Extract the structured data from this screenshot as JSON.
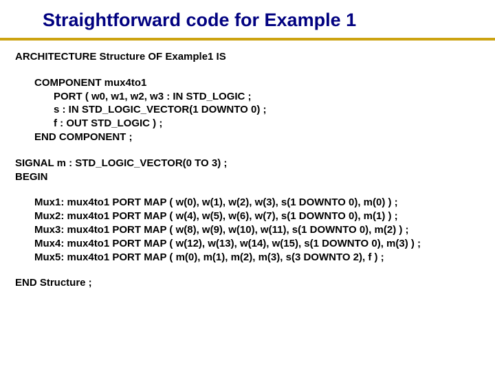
{
  "title": "Straightforward code for Example 1",
  "arch_line": "ARCHITECTURE Structure OF Example1 IS",
  "component": {
    "l1": "COMPONENT mux4to1",
    "l2": "PORT ( w0, w1, w2, w3 : IN STD_LOGIC ;",
    "l3": "s : IN STD_LOGIC_VECTOR(1 DOWNTO 0) ;",
    "l4": "f : OUT STD_LOGIC ) ;",
    "l5": "END COMPONENT ;"
  },
  "signal_line": "SIGNAL m : STD_LOGIC_VECTOR(0 TO 3) ;",
  "begin_line": "BEGIN",
  "mux": {
    "m1": "Mux1: mux4to1 PORT MAP ( w(0), w(1), w(2), w(3), s(1 DOWNTO 0), m(0) ) ;",
    "m2": "Mux2: mux4to1 PORT MAP ( w(4), w(5), w(6), w(7), s(1 DOWNTO 0), m(1) ) ;",
    "m3": "Mux3: mux4to1 PORT MAP ( w(8), w(9), w(10), w(11), s(1 DOWNTO 0), m(2) ) ;",
    "m4": "Mux4: mux4to1 PORT MAP ( w(12), w(13), w(14), w(15), s(1 DOWNTO 0), m(3) ) ;",
    "m5": "Mux5: mux4to1 PORT MAP ( m(0), m(1), m(2), m(3), s(3 DOWNTO 2), f ) ;"
  },
  "end_line": "END Structure ;"
}
